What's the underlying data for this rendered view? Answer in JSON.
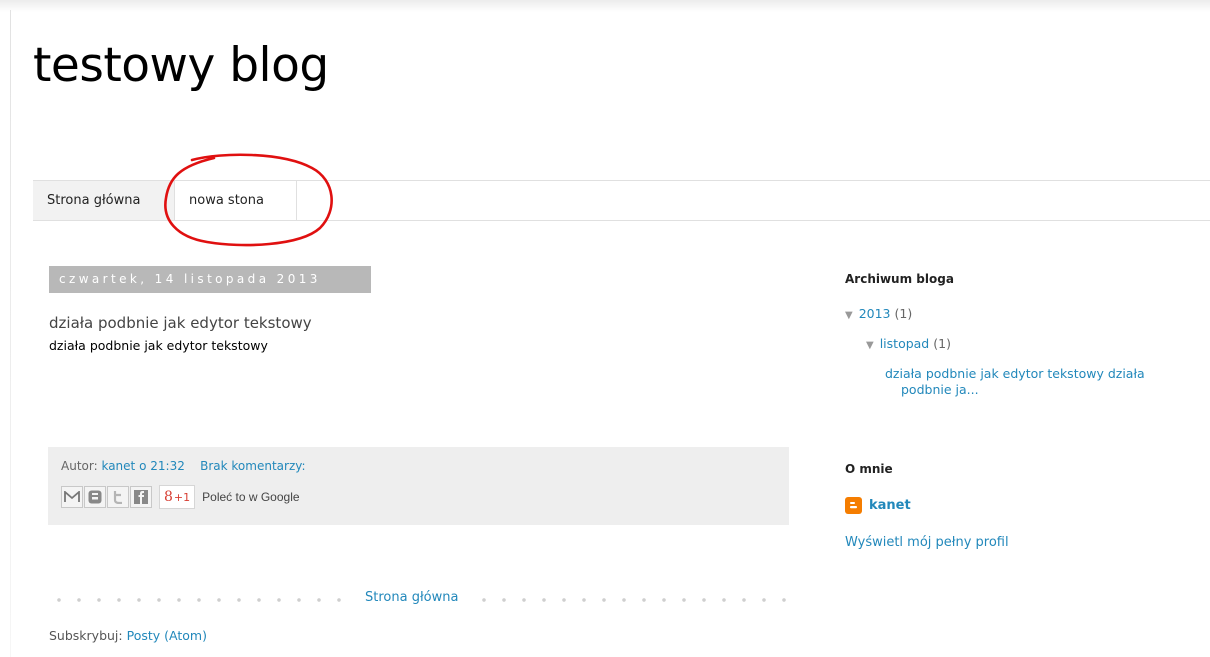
{
  "blog": {
    "title": "testowy blog"
  },
  "tabs": [
    {
      "label": "Strona główna"
    },
    {
      "label": "nowa stona"
    }
  ],
  "post": {
    "date_header": "czwartek, 14 listopada 2013",
    "title": "działa podbnie jak edytor tekstowy",
    "body": "działa podbnie jak edytor tekstowy",
    "footer": {
      "author_prefix": "Autor:",
      "author": "kanet",
      "time_prefix": "o",
      "time": "21:32",
      "comments": "Brak komentarzy:",
      "share_buttons": [
        {
          "label": "M",
          "icon": "email-icon"
        },
        {
          "label": "B",
          "icon": "blogger-icon"
        },
        {
          "label": "t",
          "icon": "twitter-icon"
        },
        {
          "label": "f",
          "icon": "facebook-icon"
        }
      ],
      "gplus_label": "8",
      "gplus_suffix": "+1",
      "recommend": "Poleć to w Google"
    }
  },
  "pager": {
    "home": "Strona główna"
  },
  "subscribe": {
    "label": "Subskrybuj:",
    "link": "Posty (Atom)"
  },
  "sidebar": {
    "archive": {
      "title": "Archiwum bloga",
      "year": {
        "label": "2013",
        "count": "(1)"
      },
      "month": {
        "label": "listopad",
        "count": "(1)"
      },
      "post_link": "działa podbnie jak edytor tekstowy działa podbnie ja..."
    },
    "about": {
      "title": "O mnie",
      "name": "kanet",
      "full_profile": "Wyświetl mój pełny profil"
    }
  },
  "colors": {
    "link": "#2288bb",
    "annotation": "#e01010"
  }
}
